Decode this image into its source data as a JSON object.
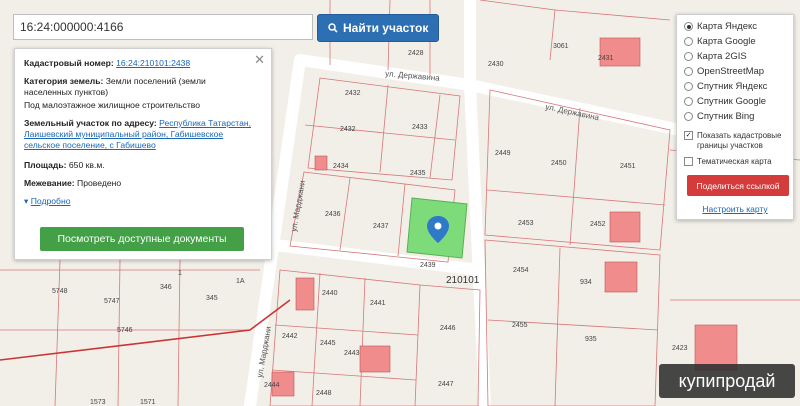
{
  "search": {
    "value": "16:24:000000:4166",
    "button_label": "Найти участок",
    "button_icon": "search-icon"
  },
  "info_panel": {
    "close_icon": "close-icon",
    "cadastral_label": "Кадастровый номер:",
    "cadastral_number": "16:24:210101:2438",
    "category_label": "Категория земель:",
    "category_value_1": "Земли поселений (земли",
    "category_value_2": "населенных пунктов)",
    "category_value_3": "Под малоэтажное жилищное строительство",
    "address_label": "Земельный участок по адресу:",
    "address_1": "Республика Татарстан,",
    "address_2": "Лаишевский муниципальный район, Габишевское",
    "address_3": "сельское поселение, с Габишево",
    "area_label": "Площадь:",
    "area_value": "650 кв.м.",
    "survey_label": "Межевание:",
    "survey_value": "Проведено",
    "more_link": "Подробно",
    "docs_button": "Посмотреть доступные документы"
  },
  "layers_panel": {
    "options": [
      {
        "label": "Карта Яндекс",
        "selected": true
      },
      {
        "label": "Карта Google",
        "selected": false
      },
      {
        "label": "Карта 2GIS",
        "selected": false
      },
      {
        "label": "OpenStreetMap",
        "selected": false
      },
      {
        "label": "Спутник Яндекс",
        "selected": false
      },
      {
        "label": "Спутник Google",
        "selected": false
      },
      {
        "label": "Спутник Bing",
        "selected": false
      }
    ],
    "show_cadastral_1": "Показать кадастровые",
    "show_cadastral_2": "границы участков",
    "show_cadastral_checked": true,
    "thematic_map": "Тематическая карта",
    "thematic_checked": false,
    "share_button": "Поделиться ссылкой",
    "setup_link": "Настроить карту"
  },
  "map": {
    "streets": {
      "derzhavina_1": "ул. Державина",
      "derzhavina_2": "ул. Державина",
      "mardzhani_1": "ул. Марджани",
      "mardzhani_2": "ул. Марджани"
    },
    "quarter": "210101",
    "plots": [
      "2428",
      "3061",
      "2430",
      "2431",
      "2432",
      "2433",
      "2432",
      "2434",
      "2435",
      "2449",
      "2450",
      "2451",
      "2436",
      "2437",
      "2438",
      "2453",
      "2452",
      "2439",
      "2454",
      "934",
      "2440",
      "2441",
      "2446",
      "2455",
      "2442",
      "2443",
      "2445",
      "935",
      "2447",
      "2444",
      "2448",
      "2423",
      "5748",
      "5747",
      "5746",
      "346",
      "345",
      "1",
      "1А",
      "1571",
      "1573"
    ],
    "selected_plot_color": "#7ddb7a",
    "marker_icon": "map-pin-icon",
    "building_color": "#f08c8c"
  },
  "watermark": "купипродай"
}
